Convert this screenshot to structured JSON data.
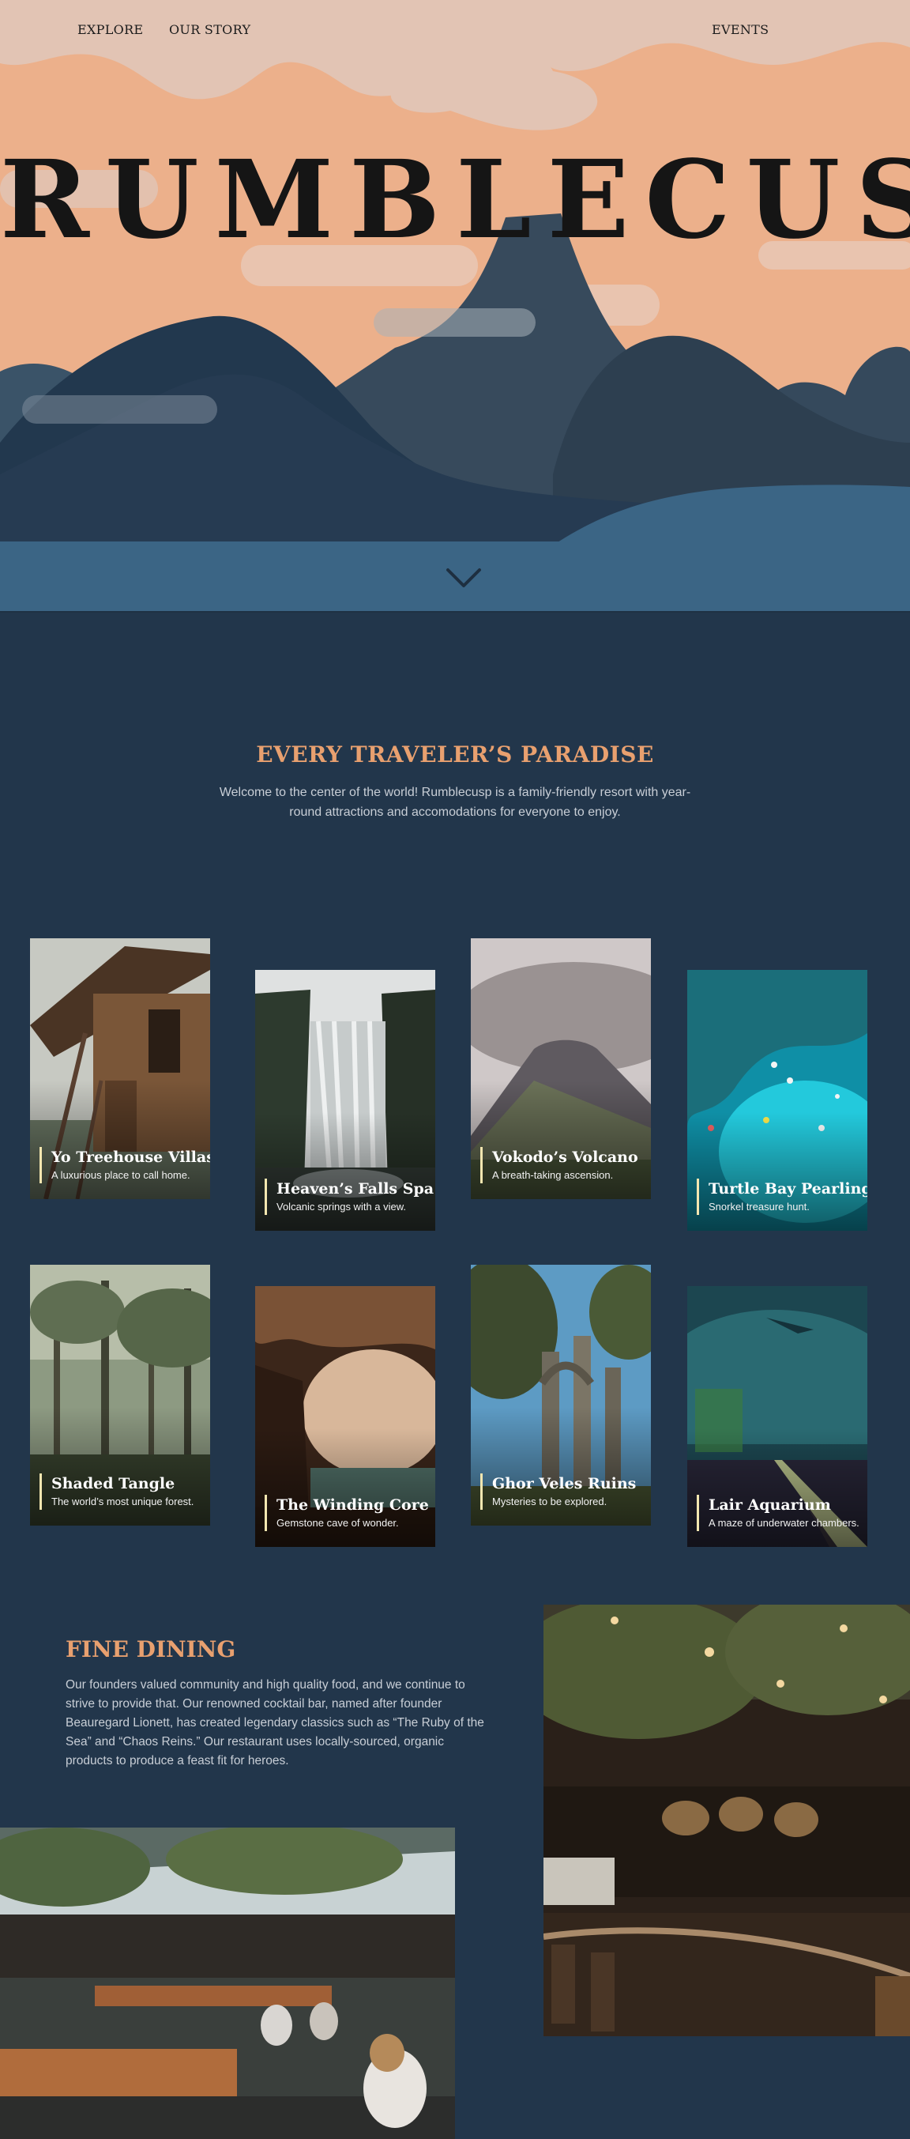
{
  "nav": {
    "explore": "EXPLORE",
    "our_story": "OUR STORY",
    "events": "EVENTS"
  },
  "hero": {
    "title": "RUMBLECUSP"
  },
  "paradise": {
    "title": "EVERY TRAVELER’S PARADISE",
    "text": "Welcome to the center of the world! Rumblecusp is a family-friendly resort with year-round attractions and accomodations for everyone to enjoy."
  },
  "attractions": [
    {
      "title": "Yo Treehouse Villas",
      "subtitle": "A luxurious place to call home."
    },
    {
      "title": "Heaven’s Falls Spa",
      "subtitle": "Volcanic springs with a view."
    },
    {
      "title": "Vokodo’s Volcano",
      "subtitle": "A breath-taking ascension."
    },
    {
      "title": "Turtle Bay Pearling",
      "subtitle": "Snorkel treasure hunt."
    },
    {
      "title": "Shaded Tangle",
      "subtitle": "The world’s most unique forest."
    },
    {
      "title": "The Winding Core",
      "subtitle": "Gemstone cave of wonder."
    },
    {
      "title": "Ghor Veles Ruins",
      "subtitle": "Mysteries to be explored."
    },
    {
      "title": "Lair Aquarium",
      "subtitle": "A maze of underwater chambers."
    }
  ],
  "dining": {
    "title": "FINE DINING",
    "text": "Our founders valued community and high quality food, and we continue to strive to provide that. Our renowned cocktail bar, named after founder Beauregard Lionett, has created legendary classics such as “The Ruby of the Sea” and “Chaos Reins.” Our restaurant uses locally-sourced, organic products to produce a feast fit for heroes."
  },
  "icons": {
    "scroll_down": "chevron-down-icon"
  },
  "colors": {
    "accent": "#e8a06f",
    "background": "#22364b",
    "sky": "#eaae86",
    "water": "#3b6585"
  }
}
